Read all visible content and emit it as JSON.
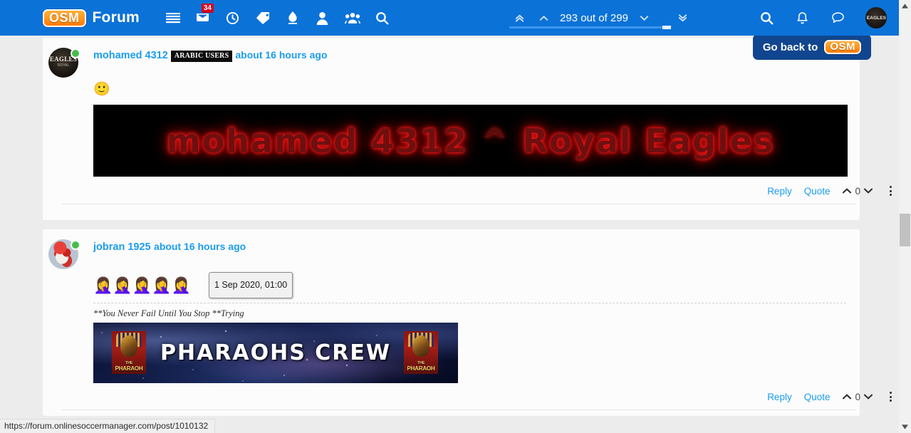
{
  "navbar": {
    "logo_text": "OSM",
    "title": "Forum",
    "icons": [
      {
        "name": "list-icon",
        "label": "Categories"
      },
      {
        "name": "inbox-icon",
        "label": "Inbox",
        "badge": "34"
      },
      {
        "name": "clock-icon",
        "label": "Recent"
      },
      {
        "name": "tag-icon",
        "label": "Tags"
      },
      {
        "name": "flame-icon",
        "label": "Popular"
      },
      {
        "name": "user-icon",
        "label": "Profile"
      },
      {
        "name": "group-icon",
        "label": "Groups"
      },
      {
        "name": "search-icon",
        "label": "Search"
      }
    ],
    "pager": {
      "first_label": "«",
      "prev_label": "‹",
      "counter": "293 out of 299",
      "next_label": "›",
      "last_label": "»",
      "progress_percent": 98
    },
    "right_icons": [
      {
        "name": "search-icon",
        "label": "Search"
      },
      {
        "name": "bell-icon",
        "label": "Notifications"
      },
      {
        "name": "chat-icon",
        "label": "Messages"
      }
    ],
    "account_avatar_label": "EAGLES"
  },
  "goback": {
    "label": "Go back to",
    "logo_text": "OSM"
  },
  "posts": [
    {
      "author": "mohamed 4312",
      "badge": "ARABIC USERS",
      "time": "about 16 hours ago",
      "avatar_label": "EAGLES",
      "avatar_sub": "ROYAL",
      "online": true,
      "emoji": "🙂",
      "banner": {
        "type": "red-glow",
        "text_left": "mohamed 4312",
        "caret": "^",
        "text_right": "Royal Eagles"
      },
      "actions": {
        "reply": "Reply",
        "quote": "Quote",
        "votes": "0",
        "up_icon": "chevron-up-icon",
        "down_icon": "chevron-down-icon",
        "more_icon": "kebab-menu-icon"
      }
    },
    {
      "author": "jobran 1925",
      "badge": "",
      "time": "about 16 hours ago",
      "avatar_label": "",
      "online": true,
      "emoji_row": "🤦‍♀️🤦‍♀️🤦‍♀️🤦‍♀️🤦‍♀️",
      "tooltip": "1 Sep 2020, 01:00",
      "signature": "**You Never Fail Until You Stop **Trying",
      "banner": {
        "type": "galaxy",
        "text": "PHARAOHS CREW",
        "side_caption": "THE",
        "side_caption_2": "PHARAOH"
      },
      "actions": {
        "reply": "Reply",
        "quote": "Quote",
        "votes": "0",
        "up_icon": "chevron-up-icon",
        "down_icon": "chevron-down-icon",
        "more_icon": "kebab-menu-icon"
      }
    }
  ],
  "statusbar": {
    "url": "https://forum.onlinesoccermanager.com/post/1010132"
  },
  "colors": {
    "nav_blue": "#0b72d8",
    "link_blue": "#1b9df0",
    "goback_blue": "#10468f",
    "badge_red": "#d4021d",
    "online_green": "#46bd4b",
    "page_bg": "#ececec",
    "card_bg": "#fcfcfc"
  }
}
